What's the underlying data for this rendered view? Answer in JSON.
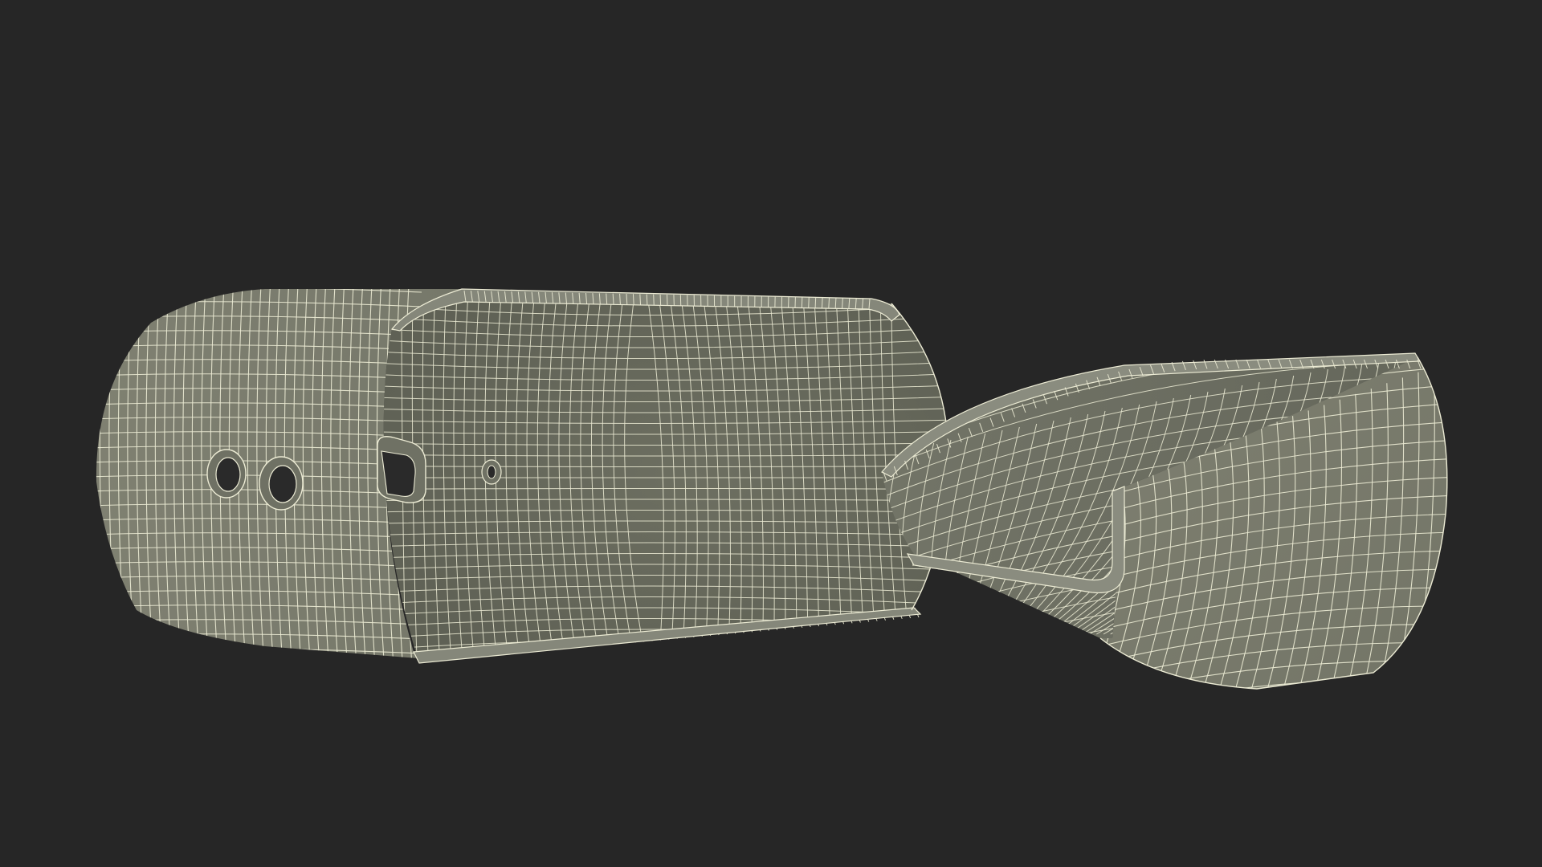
{
  "scene": {
    "background_color": "#262626",
    "surface_color": "#7c7d6d",
    "surface_dark_color": "#55574b",
    "wire_color": "#ecebd4"
  },
  "objects": [
    {
      "name": "case-shell",
      "label": "",
      "holes": 4
    },
    {
      "name": "case-lid",
      "label": ""
    }
  ]
}
